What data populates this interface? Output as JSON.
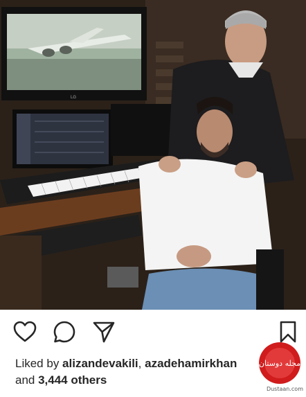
{
  "post": {
    "image_alt": "Two men in a music studio with a keyboard, monitors and a TV screen",
    "tv_brand": "LG"
  },
  "actions": {
    "like_icon": "heart-icon",
    "comment_icon": "comment-icon",
    "share_icon": "send-icon",
    "save_icon": "bookmark-icon"
  },
  "likes": {
    "prefix": "Liked by ",
    "user1": "alizandevakili",
    "separator": ", ",
    "user2": "azadehamirkhan",
    "and": "and ",
    "others": "3,444 others"
  },
  "watermark": {
    "logo_text": "مجله دوستان",
    "url": "Dustaan.com"
  },
  "colors": {
    "text": "#262626",
    "watermark_red": "#d01c1c"
  }
}
